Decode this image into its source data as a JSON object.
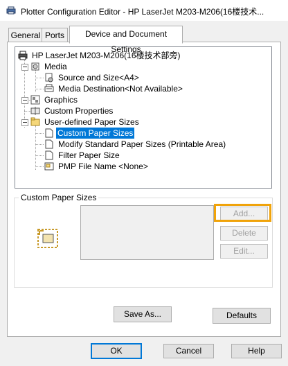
{
  "window": {
    "title": "Plotter Configuration Editor - HP LaserJet M203-M206(16楼技术..."
  },
  "tabs": [
    {
      "label": "General",
      "active": false
    },
    {
      "label": "Ports",
      "active": false
    },
    {
      "label": "Device and Document Settings",
      "active": true
    }
  ],
  "tree": {
    "root": "HP LaserJet M203-M206(16楼技术部旁)",
    "media": "Media",
    "source_size": "Source and Size<A4>",
    "media_destination": "Media Destination<Not Available>",
    "graphics": "Graphics",
    "custom_properties": "Custom Properties",
    "user_defined": "User-defined Paper Sizes",
    "custom_paper_sizes": "Custom Paper Sizes",
    "modify_standard": "Modify Standard Paper Sizes (Printable Area)",
    "filter_paper": "Filter Paper Size",
    "pmp_file": "PMP File Name <None>"
  },
  "group": {
    "title": "Custom Paper Sizes",
    "add_label": "Add...",
    "delete_label": "Delete",
    "edit_label": "Edit..."
  },
  "actions": {
    "save_as": "Save As...",
    "defaults": "Defaults"
  },
  "footer": {
    "ok": "OK",
    "cancel": "Cancel",
    "help": "Help"
  },
  "colors": {
    "selection": "#0078d7",
    "highlight": "#f0a30a"
  }
}
